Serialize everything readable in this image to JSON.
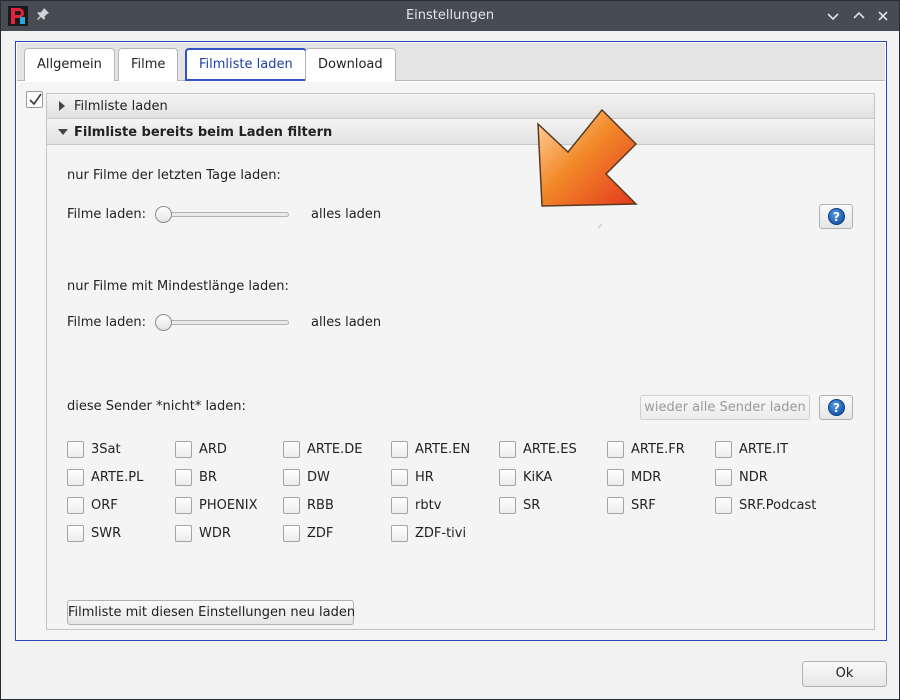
{
  "window": {
    "title": "Einstellungen"
  },
  "tabs": [
    {
      "label": "Allgemein",
      "active": false
    },
    {
      "label": "Filme",
      "active": false
    },
    {
      "label": "Filmliste laden",
      "active": true
    },
    {
      "label": "Download",
      "active": false
    }
  ],
  "panel": {
    "enabled": true,
    "section_collapsed_label": "Filmliste laden",
    "section_expanded_label": "Filmliste bereits beim Laden filtern"
  },
  "filter_days": {
    "heading": "nur Filme der letzten Tage laden:",
    "slider_label": "Filme laden:",
    "value_text": "alles laden",
    "slider_value": 0
  },
  "filter_length": {
    "heading": "nur Filme mit Mindestlänge laden:",
    "slider_label": "Filme laden:",
    "value_text": "alles laden",
    "slider_value": 0
  },
  "senders": {
    "heading": "diese Sender  *nicht*  laden:",
    "reset_button_label": "wieder alle Sender laden",
    "items": [
      {
        "label": "3Sat",
        "checked": false
      },
      {
        "label": "ARD",
        "checked": false
      },
      {
        "label": "ARTE.DE",
        "checked": false
      },
      {
        "label": "ARTE.EN",
        "checked": false
      },
      {
        "label": "ARTE.ES",
        "checked": false
      },
      {
        "label": "ARTE.FR",
        "checked": false
      },
      {
        "label": "ARTE.IT",
        "checked": false
      },
      {
        "label": "ARTE.PL",
        "checked": false
      },
      {
        "label": "BR",
        "checked": false
      },
      {
        "label": "DW",
        "checked": false
      },
      {
        "label": "HR",
        "checked": false
      },
      {
        "label": "KiKA",
        "checked": false
      },
      {
        "label": "MDR",
        "checked": false
      },
      {
        "label": "NDR",
        "checked": false
      },
      {
        "label": "ORF",
        "checked": false
      },
      {
        "label": "PHOENIX",
        "checked": false
      },
      {
        "label": "RBB",
        "checked": false
      },
      {
        "label": "rbtv",
        "checked": false
      },
      {
        "label": "SR",
        "checked": false
      },
      {
        "label": "SRF",
        "checked": false
      },
      {
        "label": "SRF.Podcast",
        "checked": false
      },
      {
        "label": "SWR",
        "checked": false
      },
      {
        "label": "WDR",
        "checked": false
      },
      {
        "label": "ZDF",
        "checked": false
      },
      {
        "label": "ZDF-tivi",
        "checked": false
      }
    ]
  },
  "reload_button_label": "Filmliste mit diesen Einstellungen neu laden",
  "ok_button_label": "Ok",
  "icons": {
    "app": "app-logo-icon",
    "pin": "pin-icon",
    "minimize": "chevron-down-icon",
    "maximize": "chevron-up-icon",
    "close": "close-icon",
    "help": "help-icon",
    "arrow": "orange-arrow-icon"
  },
  "colors": {
    "accent": "#2c47b5",
    "titlebar": "#474c52",
    "arrow": "#f06a1a"
  }
}
